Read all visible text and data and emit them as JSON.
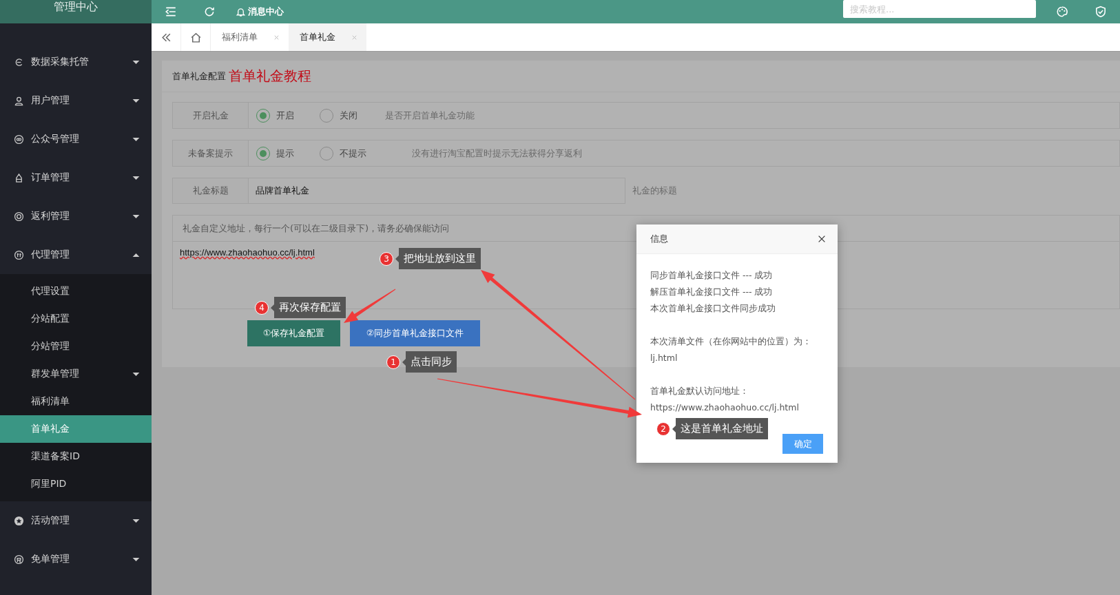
{
  "header": {
    "title": "管理中心",
    "notifications": "消息中心",
    "search": {
      "placeholder": "搜索教程..."
    }
  },
  "sidebar": {
    "items": [
      {
        "label": "数据采集托管",
        "expanded": false
      },
      {
        "label": "用户管理",
        "expanded": false
      },
      {
        "label": "公众号管理",
        "expanded": false
      },
      {
        "label": "订单管理",
        "expanded": false
      },
      {
        "label": "返利管理",
        "expanded": false
      },
      {
        "label": "代理管理",
        "expanded": true,
        "children": [
          {
            "kind": "link",
            "label": "代理设置",
            "selected": false
          },
          {
            "kind": "link",
            "label": "分站配置",
            "selected": false
          },
          {
            "kind": "link",
            "label": "分站管理",
            "selected": false
          },
          {
            "kind": "group",
            "label": "群发单管理",
            "selected": false,
            "expanded": false
          },
          {
            "kind": "link",
            "label": "福利清单",
            "selected": false
          },
          {
            "kind": "link",
            "label": "首单礼金",
            "selected": true
          },
          {
            "kind": "link",
            "label": "渠道备案ID",
            "selected": false
          },
          {
            "kind": "link",
            "label": "阿里PID",
            "selected": false
          }
        ]
      },
      {
        "label": "活动管理",
        "expanded": false
      },
      {
        "label": "免单管理",
        "expanded": false
      }
    ]
  },
  "tabs": [
    {
      "label": "福利清单",
      "selected": false
    },
    {
      "label": "首单礼金",
      "selected": true
    }
  ],
  "card": {
    "subtitle": "首单礼金配置",
    "title": "首单礼金教程",
    "fields": [
      {
        "kind": "radio",
        "label": "开启礼金",
        "options": [
          {
            "label": "开启",
            "selected": true
          },
          {
            "label": "关闭",
            "selected": false
          }
        ],
        "hint": "是否开启首单礼金功能"
      },
      {
        "kind": "radio",
        "label": "未备案提示",
        "options": [
          {
            "label": "提示",
            "selected": true
          },
          {
            "label": "不提示",
            "selected": false
          }
        ],
        "hint": "没有进行淘宝配置时提示无法获得分享返利"
      },
      {
        "kind": "text",
        "label": "礼金标题",
        "value": "品牌首单礼金",
        "hint": "礼金的标题"
      },
      {
        "kind": "textarea",
        "label": "礼金自定义地址，每行一个(可以在二级目录下)，请务必确保能访问",
        "value": "https://www.zhaohaohuo.cc/lj.html"
      }
    ],
    "buttons": [
      {
        "kind": "primary",
        "label": "①保存礼金配置"
      },
      {
        "kind": "info",
        "label": "②同步首单礼金接口文件"
      }
    ]
  },
  "dialog": {
    "title": "信息",
    "paragraphs": [
      [
        "同步首单礼金接口文件 --- 成功",
        "解压首单礼金接口文件 --- 成功",
        "本次首单礼金接口文件同步成功"
      ],
      [
        "本次清单文件（在你网站中的位置）为：",
        "lj.html"
      ],
      [
        "首单礼金默认访问地址：",
        "https://www.zhaohaohuo.cc/lj.html"
      ]
    ],
    "button": "确定"
  },
  "annotations": [
    {
      "number": "3",
      "text": "把地址放到这里"
    },
    {
      "number": "4",
      "text": "再次保存配置"
    },
    {
      "number": "1",
      "text": "点击同步"
    },
    {
      "number": "2",
      "text": "这是首单礼金地址"
    }
  ]
}
